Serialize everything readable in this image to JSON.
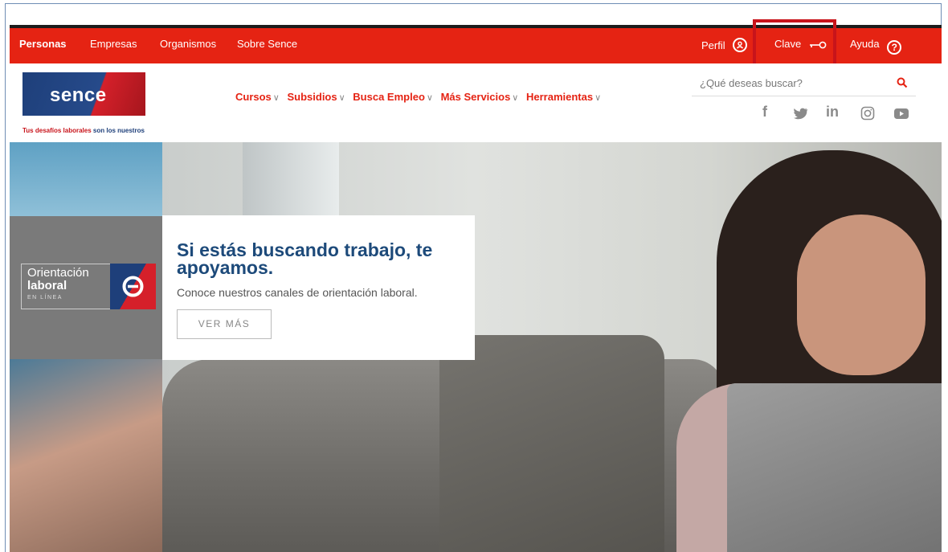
{
  "topbar": {
    "links": [
      "Personas",
      "Empresas",
      "Organismos",
      "Sobre Sence"
    ],
    "perfil": "Perfil",
    "clave": "Clave",
    "ayuda": "Ayuda"
  },
  "brand": {
    "logo_text": "sence",
    "tagline_red": "Tus desafíos laborales",
    "tagline_dark": "son los nuestros"
  },
  "nav": {
    "items": [
      "Cursos",
      "Subsidios",
      "Busca Empleo",
      "Más Servicios",
      "Herramientas"
    ]
  },
  "search": {
    "placeholder": "¿Qué deseas buscar?"
  },
  "social": [
    "f",
    "in"
  ],
  "hero": {
    "side_title_1": "Orientación",
    "side_title_2": "laboral",
    "side_title_3": "EN LÍNEA",
    "headline": "Si estás buscando trabajo, te apoyamos.",
    "subtitle": "Conoce nuestros canales de orientación laboral.",
    "cta": "VER MÁS"
  },
  "colors": {
    "brand_red": "#e52313",
    "brand_blue": "#1d4a7a",
    "highlight": "#c8141b"
  }
}
